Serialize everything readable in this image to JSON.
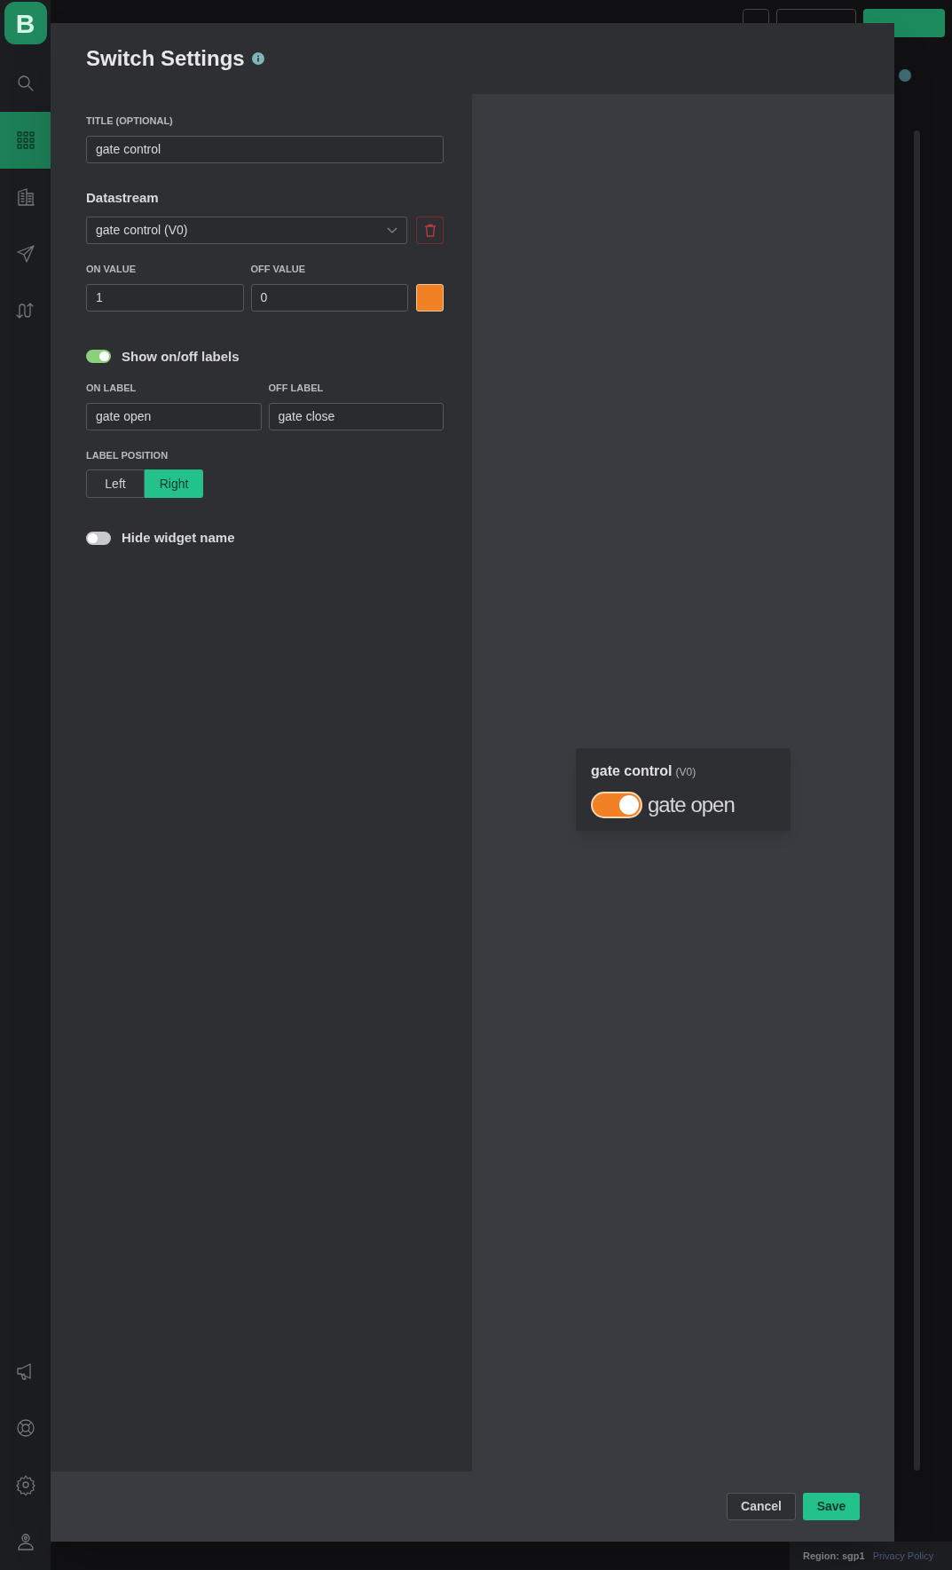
{
  "background": {
    "buttons": [
      {
        "kind": "menu"
      },
      {
        "kind": "secondary"
      },
      {
        "kind": "primary"
      }
    ],
    "region": "Region: sgp1",
    "link": "Privacy Policy"
  },
  "sidebar": {
    "logo": "B",
    "items": [
      {
        "kind": "search",
        "selected": false
      },
      {
        "kind": "grid",
        "selected": true
      },
      {
        "kind": "building",
        "selected": false
      },
      {
        "kind": "send",
        "selected": false
      },
      {
        "kind": "flow",
        "selected": false
      }
    ],
    "bottom_items": [
      {
        "kind": "megaphone"
      },
      {
        "kind": "lifebuoy"
      },
      {
        "kind": "settings"
      },
      {
        "kind": "user"
      }
    ]
  },
  "modal": {
    "title": "Switch Settings",
    "title_field": {
      "label": "TITLE (OPTIONAL)",
      "value": "gate control"
    },
    "datastream": {
      "heading": "Datastream",
      "value": "gate control (V0)"
    },
    "on_value": {
      "label": "ON VALUE",
      "value": "1"
    },
    "off_value": {
      "label": "OFF VALUE",
      "value": "0"
    },
    "color": "#f08125",
    "show_labels": {
      "label": "Show on/off labels",
      "on": true
    },
    "on_label": {
      "label": "ON LABEL",
      "value": "gate open"
    },
    "off_label": {
      "label": "OFF LABEL",
      "value": "gate close"
    },
    "label_position": {
      "label": "LABEL POSITION",
      "options": [
        {
          "label": "Left",
          "selected": false
        },
        {
          "label": "Right",
          "selected": true
        }
      ]
    },
    "hide_name": {
      "label": "Hide widget name",
      "on": false
    },
    "preview": {
      "title": "gate control",
      "pin": "(V0)",
      "on": true,
      "state_label": "gate open"
    },
    "buttons": [
      {
        "label": "Cancel",
        "kind": "secondary"
      },
      {
        "label": "Save",
        "kind": "primary"
      }
    ]
  }
}
